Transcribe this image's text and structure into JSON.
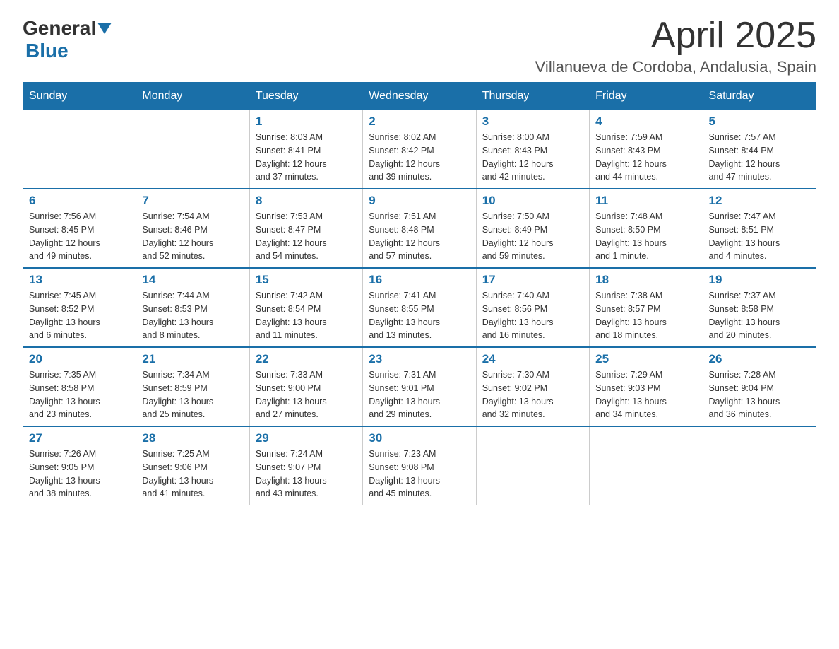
{
  "header": {
    "logo_general": "General",
    "logo_blue": "Blue",
    "month": "April 2025",
    "location": "Villanueva de Cordoba, Andalusia, Spain"
  },
  "columns": [
    "Sunday",
    "Monday",
    "Tuesday",
    "Wednesday",
    "Thursday",
    "Friday",
    "Saturday"
  ],
  "weeks": [
    [
      {
        "day": "",
        "info": ""
      },
      {
        "day": "",
        "info": ""
      },
      {
        "day": "1",
        "info": "Sunrise: 8:03 AM\nSunset: 8:41 PM\nDaylight: 12 hours\nand 37 minutes."
      },
      {
        "day": "2",
        "info": "Sunrise: 8:02 AM\nSunset: 8:42 PM\nDaylight: 12 hours\nand 39 minutes."
      },
      {
        "day": "3",
        "info": "Sunrise: 8:00 AM\nSunset: 8:43 PM\nDaylight: 12 hours\nand 42 minutes."
      },
      {
        "day": "4",
        "info": "Sunrise: 7:59 AM\nSunset: 8:43 PM\nDaylight: 12 hours\nand 44 minutes."
      },
      {
        "day": "5",
        "info": "Sunrise: 7:57 AM\nSunset: 8:44 PM\nDaylight: 12 hours\nand 47 minutes."
      }
    ],
    [
      {
        "day": "6",
        "info": "Sunrise: 7:56 AM\nSunset: 8:45 PM\nDaylight: 12 hours\nand 49 minutes."
      },
      {
        "day": "7",
        "info": "Sunrise: 7:54 AM\nSunset: 8:46 PM\nDaylight: 12 hours\nand 52 minutes."
      },
      {
        "day": "8",
        "info": "Sunrise: 7:53 AM\nSunset: 8:47 PM\nDaylight: 12 hours\nand 54 minutes."
      },
      {
        "day": "9",
        "info": "Sunrise: 7:51 AM\nSunset: 8:48 PM\nDaylight: 12 hours\nand 57 minutes."
      },
      {
        "day": "10",
        "info": "Sunrise: 7:50 AM\nSunset: 8:49 PM\nDaylight: 12 hours\nand 59 minutes."
      },
      {
        "day": "11",
        "info": "Sunrise: 7:48 AM\nSunset: 8:50 PM\nDaylight: 13 hours\nand 1 minute."
      },
      {
        "day": "12",
        "info": "Sunrise: 7:47 AM\nSunset: 8:51 PM\nDaylight: 13 hours\nand 4 minutes."
      }
    ],
    [
      {
        "day": "13",
        "info": "Sunrise: 7:45 AM\nSunset: 8:52 PM\nDaylight: 13 hours\nand 6 minutes."
      },
      {
        "day": "14",
        "info": "Sunrise: 7:44 AM\nSunset: 8:53 PM\nDaylight: 13 hours\nand 8 minutes."
      },
      {
        "day": "15",
        "info": "Sunrise: 7:42 AM\nSunset: 8:54 PM\nDaylight: 13 hours\nand 11 minutes."
      },
      {
        "day": "16",
        "info": "Sunrise: 7:41 AM\nSunset: 8:55 PM\nDaylight: 13 hours\nand 13 minutes."
      },
      {
        "day": "17",
        "info": "Sunrise: 7:40 AM\nSunset: 8:56 PM\nDaylight: 13 hours\nand 16 minutes."
      },
      {
        "day": "18",
        "info": "Sunrise: 7:38 AM\nSunset: 8:57 PM\nDaylight: 13 hours\nand 18 minutes."
      },
      {
        "day": "19",
        "info": "Sunrise: 7:37 AM\nSunset: 8:58 PM\nDaylight: 13 hours\nand 20 minutes."
      }
    ],
    [
      {
        "day": "20",
        "info": "Sunrise: 7:35 AM\nSunset: 8:58 PM\nDaylight: 13 hours\nand 23 minutes."
      },
      {
        "day": "21",
        "info": "Sunrise: 7:34 AM\nSunset: 8:59 PM\nDaylight: 13 hours\nand 25 minutes."
      },
      {
        "day": "22",
        "info": "Sunrise: 7:33 AM\nSunset: 9:00 PM\nDaylight: 13 hours\nand 27 minutes."
      },
      {
        "day": "23",
        "info": "Sunrise: 7:31 AM\nSunset: 9:01 PM\nDaylight: 13 hours\nand 29 minutes."
      },
      {
        "day": "24",
        "info": "Sunrise: 7:30 AM\nSunset: 9:02 PM\nDaylight: 13 hours\nand 32 minutes."
      },
      {
        "day": "25",
        "info": "Sunrise: 7:29 AM\nSunset: 9:03 PM\nDaylight: 13 hours\nand 34 minutes."
      },
      {
        "day": "26",
        "info": "Sunrise: 7:28 AM\nSunset: 9:04 PM\nDaylight: 13 hours\nand 36 minutes."
      }
    ],
    [
      {
        "day": "27",
        "info": "Sunrise: 7:26 AM\nSunset: 9:05 PM\nDaylight: 13 hours\nand 38 minutes."
      },
      {
        "day": "28",
        "info": "Sunrise: 7:25 AM\nSunset: 9:06 PM\nDaylight: 13 hours\nand 41 minutes."
      },
      {
        "day": "29",
        "info": "Sunrise: 7:24 AM\nSunset: 9:07 PM\nDaylight: 13 hours\nand 43 minutes."
      },
      {
        "day": "30",
        "info": "Sunrise: 7:23 AM\nSunset: 9:08 PM\nDaylight: 13 hours\nand 45 minutes."
      },
      {
        "day": "",
        "info": ""
      },
      {
        "day": "",
        "info": ""
      },
      {
        "day": "",
        "info": ""
      }
    ]
  ]
}
